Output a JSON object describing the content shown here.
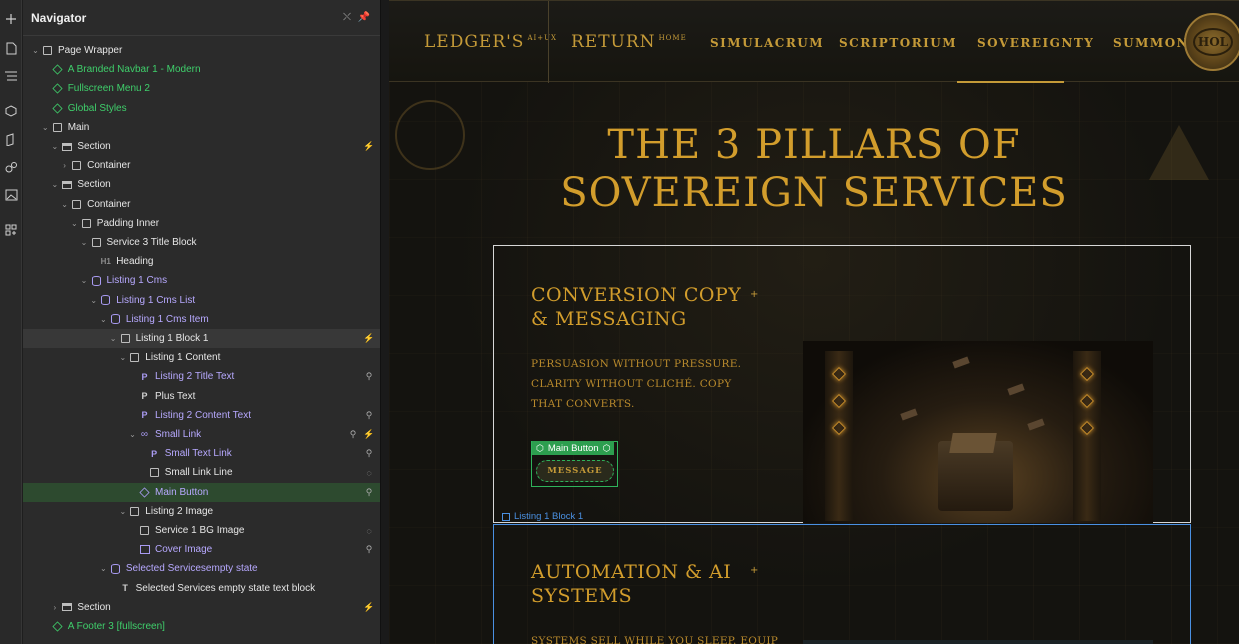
{
  "navigator": {
    "title": "Navigator",
    "tree": [
      {
        "label": "Page Wrapper",
        "indent": 0,
        "caret": "v",
        "icon": "box",
        "color": "w"
      },
      {
        "label": "A Branded Navbar 1 - Modern",
        "indent": 1,
        "caret": "",
        "icon": "cube",
        "color": "g"
      },
      {
        "label": "Fullscreen Menu 2",
        "indent": 1,
        "caret": "",
        "icon": "cube",
        "color": "g"
      },
      {
        "label": "Global Styles",
        "indent": 1,
        "caret": "",
        "icon": "cube",
        "color": "g"
      },
      {
        "label": "Main",
        "indent": 1,
        "caret": "v",
        "icon": "box",
        "color": "w"
      },
      {
        "label": "Section",
        "indent": 2,
        "caret": "v",
        "icon": "sec",
        "color": "w",
        "right2": "bolt"
      },
      {
        "label": "Container",
        "indent": 3,
        "caret": ">",
        "icon": "box",
        "color": "w"
      },
      {
        "label": "Section",
        "indent": 2,
        "caret": "v",
        "icon": "sec",
        "color": "w"
      },
      {
        "label": "Container",
        "indent": 3,
        "caret": "v",
        "icon": "box",
        "color": "w"
      },
      {
        "label": "Padding Inner",
        "indent": 4,
        "caret": "v",
        "icon": "box",
        "color": "w"
      },
      {
        "label": "Service 3 Title Block",
        "indent": 5,
        "caret": "v",
        "icon": "box",
        "color": "w"
      },
      {
        "label": "Heading",
        "indent": 6,
        "caret": "",
        "icon": "h1",
        "color": "w"
      },
      {
        "label": "Listing 1 Cms",
        "indent": 5,
        "caret": "v",
        "icon": "dbs",
        "color": "p"
      },
      {
        "label": "Listing 1 Cms List",
        "indent": 6,
        "caret": "v",
        "icon": "dbs",
        "color": "p"
      },
      {
        "label": "Listing 1 Cms Item",
        "indent": 7,
        "caret": "v",
        "icon": "dbs",
        "color": "p"
      },
      {
        "label": "Listing 1 Block 1",
        "indent": 8,
        "caret": "v",
        "icon": "box",
        "color": "w",
        "state": "sel-parent",
        "right2": "bolt"
      },
      {
        "label": "Listing 1 Content",
        "indent": 9,
        "caret": "v",
        "icon": "box",
        "color": "w"
      },
      {
        "label": "Listing 2 Title Text",
        "indent": 10,
        "caret": "",
        "icon": "txtp",
        "color": "p",
        "right2": "pin"
      },
      {
        "label": "Plus Text",
        "indent": 10,
        "caret": "",
        "icon": "txtw",
        "color": "w"
      },
      {
        "label": "Listing 2 Content Text",
        "indent": 10,
        "caret": "",
        "icon": "txtp",
        "color": "p",
        "right2": "pin"
      },
      {
        "label": "Small Link",
        "indent": 10,
        "caret": "v",
        "icon": "lnk",
        "color": "p",
        "right1": "pin",
        "right2": "bolt"
      },
      {
        "label": "Small Text Link",
        "indent": 11,
        "caret": "",
        "icon": "txtp",
        "color": "p",
        "right2": "pin"
      },
      {
        "label": "Small Link Line",
        "indent": 11,
        "caret": "",
        "icon": "box",
        "color": "w",
        "right2": "eye"
      },
      {
        "label": "Main Button",
        "indent": 10,
        "caret": "",
        "icon": "cubep",
        "color": "p",
        "state": "sel",
        "right2": "pin"
      },
      {
        "label": "Listing 2 Image",
        "indent": 9,
        "caret": "v",
        "icon": "box",
        "color": "w"
      },
      {
        "label": "Service 1 BG Image",
        "indent": 10,
        "caret": "",
        "icon": "box",
        "color": "w",
        "right2": "eye"
      },
      {
        "label": "Cover Image",
        "indent": 10,
        "caret": "",
        "icon": "img",
        "color": "p",
        "right2": "pin"
      },
      {
        "label": "Selected Servicesempty state",
        "indent": 7,
        "caret": "v",
        "icon": "dbs",
        "color": "p"
      },
      {
        "label": "Selected Services empty state text block",
        "indent": 8,
        "caret": "",
        "icon": "T",
        "color": "w"
      },
      {
        "label": "Section",
        "indent": 2,
        "caret": ">",
        "icon": "sec",
        "color": "w",
        "right2": "bolt"
      },
      {
        "label": "A Footer 3 [fullscreen]",
        "indent": 1,
        "caret": "",
        "icon": "cube",
        "color": "g"
      }
    ]
  },
  "site": {
    "logo": "LEDGER'S",
    "logo_sup": "AI+UX",
    "return": "RETURN",
    "return_sup": "HOME",
    "links": [
      "SIMULACRUM",
      "SCRIPTORIUM",
      "SOVEREIGNTY",
      "SUMMON"
    ],
    "seal": "HOL",
    "hero_line1": "THE 3 PILLARS OF",
    "hero_line2": "SOVEREIGN SERVICES"
  },
  "cards": [
    {
      "title_line1": "CONVERSION COPY",
      "title_line2": "& MESSAGING",
      "plus": "+",
      "body": "PERSUASION WITHOUT PRESSURE. CLARITY WITHOUT CLICHÉ. COPY THAT CONVERTS.",
      "button": "MESSAGE"
    },
    {
      "title_line1": "AUTOMATION & AI",
      "title_line2": "SYSTEMS",
      "plus": "+",
      "body": "SYSTEMS SELL WHILE YOU SLEEP. EQUIP"
    }
  ],
  "overlay": {
    "main_button_tag": "Main Button",
    "listing_block_tag": "Listing 1 Block 1"
  },
  "colors": {
    "gold": "#d29d2c",
    "selection_green": "#2fb35b",
    "selection_blue": "#4a90e2",
    "cms_purple": "#b7a9ff",
    "component_green": "#3fcf6b"
  }
}
